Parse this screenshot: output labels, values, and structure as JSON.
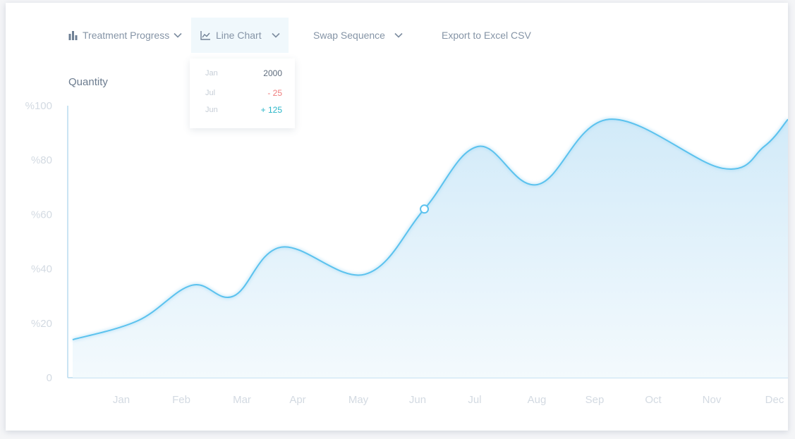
{
  "toolbar": {
    "report_select": "Treatment Progress",
    "chart_type_select": "Line Chart",
    "sequence_select": "Swap Sequence",
    "export_label": "Export to Excel CSV"
  },
  "dropdown": {
    "rows": [
      {
        "label": "Jan",
        "value": "2000"
      },
      {
        "label": "Jul",
        "value": "- 25"
      },
      {
        "label": "Jun",
        "value": "+ 125"
      }
    ]
  },
  "colors": {
    "line": "#5bc2ee",
    "fill_top": "#cfe9f8",
    "fill_bottom": "#f2f9fd",
    "axis": "#b9dcef",
    "tick_text": "#d3dae2",
    "negative": "#ef7e7e",
    "positive": "#2bb6c8"
  },
  "chart_data": {
    "type": "area",
    "title": "",
    "ylabel": "Quantity",
    "xlabel": "",
    "categories": [
      "Jan",
      "Feb",
      "Mar",
      "Apr",
      "May",
      "Jun",
      "Jul",
      "Aug",
      "Sep",
      "Oct",
      "Nov",
      "Dec"
    ],
    "y_ticks": [
      {
        "value": 0,
        "label": "0"
      },
      {
        "value": 20,
        "label": "%20"
      },
      {
        "value": 40,
        "label": "%40"
      },
      {
        "value": 60,
        "label": "%60"
      },
      {
        "value": 80,
        "label": "%80"
      },
      {
        "value": 100,
        "label": "%100"
      }
    ],
    "ylim": [
      0,
      100
    ],
    "x_range": [
      0,
      12
    ],
    "points": [
      {
        "x": 0.0,
        "y": 14
      },
      {
        "x": 1.1,
        "y": 21
      },
      {
        "x": 2.0,
        "y": 34
      },
      {
        "x": 2.7,
        "y": 30
      },
      {
        "x": 3.5,
        "y": 48
      },
      {
        "x": 4.9,
        "y": 38
      },
      {
        "x": 5.9,
        "y": 62
      },
      {
        "x": 6.8,
        "y": 85
      },
      {
        "x": 7.8,
        "y": 71
      },
      {
        "x": 9.0,
        "y": 95
      },
      {
        "x": 10.9,
        "y": 77
      },
      {
        "x": 11.6,
        "y": 85
      },
      {
        "x": 12.0,
        "y": 95
      }
    ],
    "highlight": {
      "x": 5.9,
      "y": 62
    },
    "grid": false
  }
}
